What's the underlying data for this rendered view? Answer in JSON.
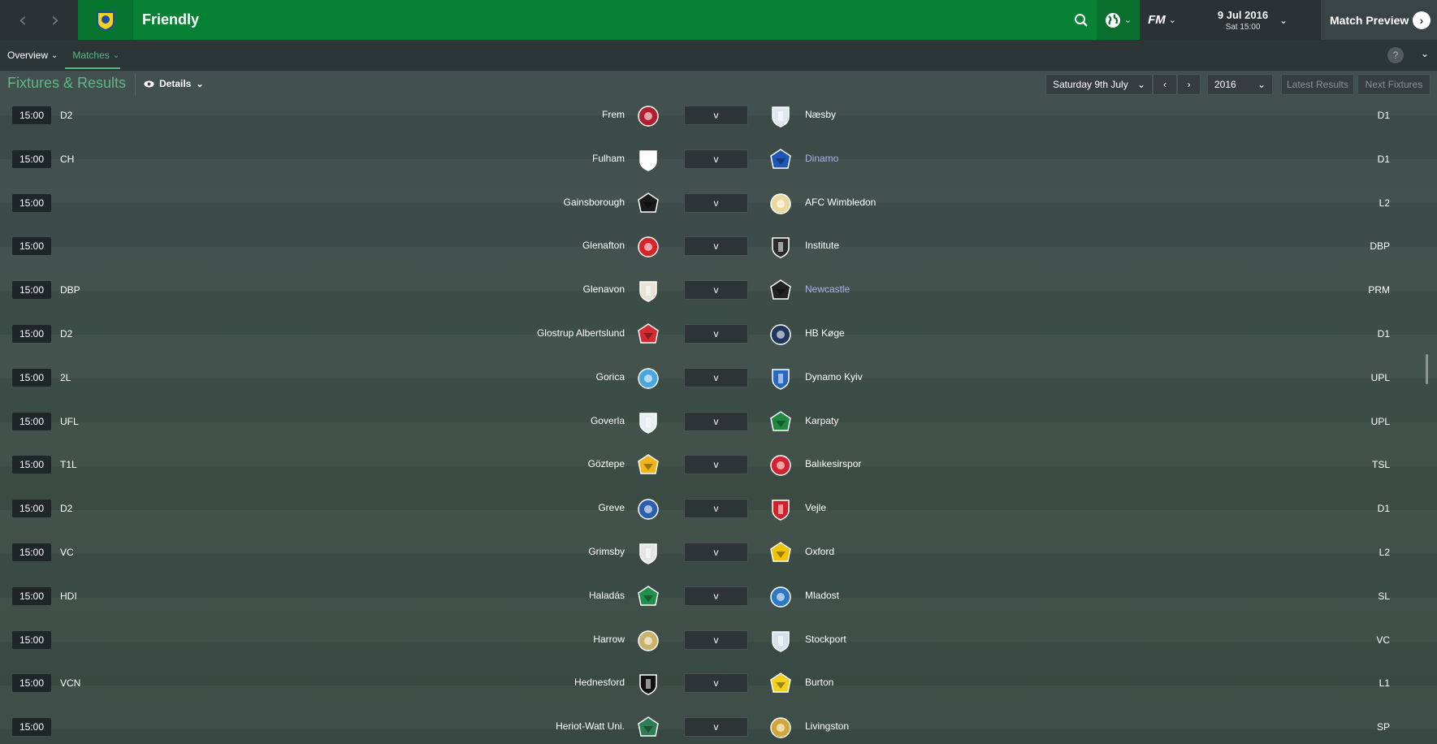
{
  "header": {
    "title": "Friendly",
    "date": "9 Jul 2016",
    "day_time": "Sat 15:00",
    "preview_label": "Match Preview"
  },
  "icons": {
    "back": "chevron-left-icon",
    "forward": "chevron-right-icon",
    "search": "search-icon",
    "world": "globe-icon",
    "fm": "fm-logo-icon"
  },
  "subnav": {
    "overview": "Overview",
    "matches": "Matches"
  },
  "section": {
    "title": "Fixtures & Results",
    "details": "Details",
    "date_select": "Saturday 9th July",
    "year_select": "2016",
    "latest_results": "Latest Results",
    "next_fixtures": "Next Fixtures"
  },
  "colors": {
    "brand_green": "#078234",
    "accent_green": "#5cb887",
    "link_blue": "#a9b4e6"
  },
  "fixtures": [
    {
      "time": "15:00",
      "comp": "D2",
      "home": "Frem",
      "vs": "v",
      "away": "Næsby",
      "away_link": false,
      "div": "D1",
      "hc": "#b11e2e",
      "ac": "#dfe6ef"
    },
    {
      "time": "15:00",
      "comp": "CH",
      "home": "Fulham",
      "vs": "v",
      "away": "Dinamo",
      "away_link": true,
      "div": "D1",
      "hc": "#ffffff",
      "ac": "#1f57b8"
    },
    {
      "time": "15:00",
      "comp": "",
      "home": "Gainsborough",
      "vs": "v",
      "away": "AFC Wimbledon",
      "away_link": false,
      "div": "L2",
      "hc": "#1a1a1a",
      "ac": "#e8d9a0"
    },
    {
      "time": "15:00",
      "comp": "",
      "home": "Glenafton",
      "vs": "v",
      "away": "Institute",
      "away_link": false,
      "div": "DBP",
      "hc": "#d8222a",
      "ac": "#2a2a2a"
    },
    {
      "time": "15:00",
      "comp": "DBP",
      "home": "Glenavon",
      "vs": "v",
      "away": "Newcastle",
      "away_link": true,
      "div": "PRM",
      "hc": "#e9e3d4",
      "ac": "#222222"
    },
    {
      "time": "15:00",
      "comp": "D2",
      "home": "Glostrup Albertslund",
      "vs": "v",
      "away": "HB Køge",
      "away_link": false,
      "div": "D1",
      "hc": "#d42a30",
      "ac": "#20385f"
    },
    {
      "time": "15:00",
      "comp": "2L",
      "home": "Gorica",
      "vs": "v",
      "away": "Dynamo Kyiv",
      "away_link": false,
      "div": "UPL",
      "hc": "#4aa6e0",
      "ac": "#2b66c0"
    },
    {
      "time": "15:00",
      "comp": "UFL",
      "home": "Goverla",
      "vs": "v",
      "away": "Karpaty",
      "away_link": false,
      "div": "UPL",
      "hc": "#e6eef0",
      "ac": "#1d8a3e"
    },
    {
      "time": "15:00",
      "comp": "T1L",
      "home": "Göztepe",
      "vs": "v",
      "away": "Balıkesirspor",
      "away_link": false,
      "div": "TSL",
      "hc": "#f0b41c",
      "ac": "#d42230"
    },
    {
      "time": "15:00",
      "comp": "D2",
      "home": "Greve",
      "vs": "v",
      "away": "Vejle",
      "away_link": false,
      "div": "D1",
      "hc": "#2d5fb0",
      "ac": "#d0202a"
    },
    {
      "time": "15:00",
      "comp": "VC",
      "home": "Grimsby",
      "vs": "v",
      "away": "Oxford",
      "away_link": false,
      "div": "L2",
      "hc": "#e5e5e5",
      "ac": "#f2c300"
    },
    {
      "time": "15:00",
      "comp": "HDI",
      "home": "Haladás",
      "vs": "v",
      "away": "Mladost",
      "away_link": false,
      "div": "SL",
      "hc": "#1f8f4a",
      "ac": "#2c79c6"
    },
    {
      "time": "15:00",
      "comp": "",
      "home": "Harrow",
      "vs": "v",
      "away": "Stockport",
      "away_link": false,
      "div": "VC",
      "hc": "#c9b26a",
      "ac": "#d6e0ea"
    },
    {
      "time": "15:00",
      "comp": "VCN",
      "home": "Hednesford",
      "vs": "v",
      "away": "Burton",
      "away_link": false,
      "div": "L1",
      "hc": "#111111",
      "ac": "#f2d21c"
    },
    {
      "time": "15:00",
      "comp": "",
      "home": "Heriot-Watt Uni.",
      "vs": "v",
      "away": "Livingston",
      "away_link": false,
      "div": "SP",
      "hc": "#2f7d52",
      "ac": "#d2a73a"
    }
  ]
}
